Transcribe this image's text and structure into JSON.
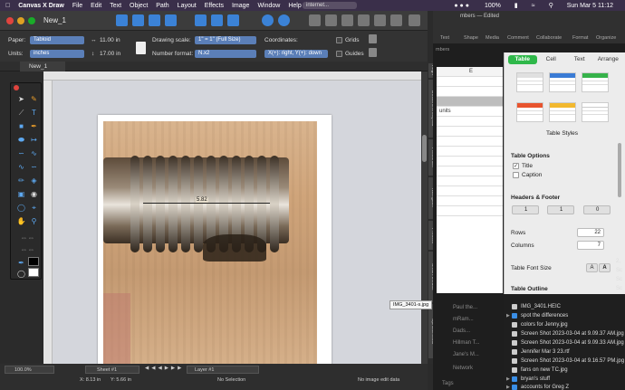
{
  "menubar": {
    "app": "Canvas X Draw",
    "items": [
      "File",
      "Edit",
      "Text",
      "Object",
      "Path",
      "Layout",
      "Effects",
      "Image",
      "Window",
      "Help"
    ],
    "url_hint": "internet...",
    "battery": "100%",
    "clock": "Sun Mar 5  11:12"
  },
  "window": {
    "title": "New_1"
  },
  "props": {
    "paper_label": "Paper:",
    "paper_value": "Tabloid",
    "width_value": "11.00 in",
    "units_label": "Units:",
    "units_value": "inches",
    "height_value": "17.00 in",
    "drawing_scale_label": "Drawing scale:",
    "drawing_scale_value": "1\" = 1\"  (Full Size)",
    "number_format_label": "Number format:",
    "number_format_value": "N.x2",
    "coordinates_label": "Coordinates:",
    "coordinates_value": "X(+): right, Y(+): down",
    "grids_label": "Grids",
    "guides_label": "Guides"
  },
  "tab": {
    "label": "New_1"
  },
  "drawing": {
    "dimension_text": "5.82"
  },
  "sidetabs": [
    "Align",
    "Document Layout",
    "Flowchart",
    "Navigator",
    "Presets",
    "Smart Mouse",
    "SpriteEffects"
  ],
  "status": {
    "zoom": "100.0%",
    "sheet": "Sheet #1",
    "layer": "Layer #1",
    "x": "X: 8.13 in",
    "y": "Y: 5.66 in",
    "selection": "No Selection",
    "image_info": "No image edit data"
  },
  "tooltip": "IMG_3401-s.jpg",
  "numbers": {
    "title": "mbers — Edited",
    "subtitle": "mbers",
    "toolbar": [
      "Text",
      "Shape",
      "Media",
      "Comment",
      "Collaborate",
      "Format",
      "Organize"
    ],
    "sheet_rows": [
      "E",
      "",
      "",
      "units",
      "",
      "",
      "",
      "",
      "",
      "",
      "",
      "",
      "",
      "",
      ""
    ],
    "sidebar": [
      "Paul the...",
      "mRam...",
      "Dads...",
      "Hillman T...",
      "Jane's M...",
      "Network",
      "Tags"
    ]
  },
  "format_panel": {
    "tabs": [
      "Table",
      "Cell",
      "Text",
      "Arrange"
    ],
    "table_styles_label": "Table Styles",
    "table_options_label": "Table Options",
    "title_label": "Title",
    "caption_label": "Caption",
    "headers_footer_label": "Headers & Footer",
    "header_rows": "1",
    "header_cols": "1",
    "footer_rows": "0",
    "rows_label": "Rows",
    "rows_value": "22",
    "columns_label": "Columns",
    "columns_value": "7",
    "font_size_label": "Table Font Size",
    "font_small": "A",
    "font_large": "A",
    "outline_label": "Table Outline"
  },
  "finder": [
    {
      "name": "IMG_3401.HEIC",
      "kind": "file"
    },
    {
      "name": "spot the differences",
      "kind": "folder"
    },
    {
      "name": "colors for Jenny.jpg",
      "kind": "file"
    },
    {
      "name": "Screen Shot 2023-03-04 at 9.09.37 AM.jpg",
      "kind": "file"
    },
    {
      "name": "Screen Shot 2023-03-04 at 9.09.33 AM.jpg",
      "kind": "file"
    },
    {
      "name": "Jennifer Mar 3 23.rtf",
      "kind": "file"
    },
    {
      "name": "Screen Shot 2023-03-04 at 9.16.57 PM.jpg",
      "kind": "file"
    },
    {
      "name": "fans on new TC.jpg",
      "kind": "file"
    },
    {
      "name": "bryan's stuff",
      "kind": "folder"
    },
    {
      "name": "accounts for Greg Z",
      "kind": "folder"
    }
  ],
  "finder_right_labels": [
    "2,",
    "Sc",
    "Sc",
    "Sc"
  ]
}
